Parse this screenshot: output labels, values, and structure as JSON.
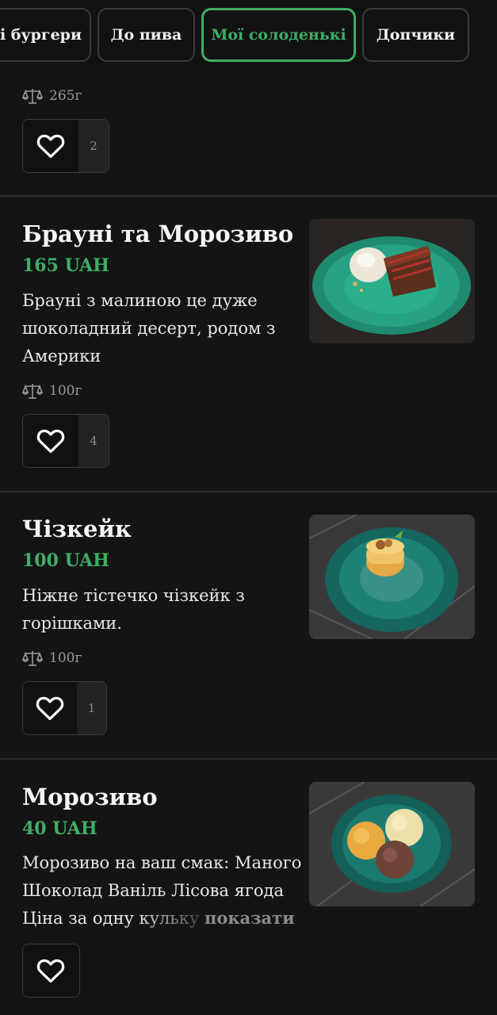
{
  "tabs": [
    {
      "label": "і бургери",
      "active": false
    },
    {
      "label": "До пива",
      "active": false
    },
    {
      "label": "Мої солоденькі",
      "active": true
    },
    {
      "label": "Допчики",
      "active": false
    }
  ],
  "colors": {
    "accent": "#3fae67",
    "background": "#141414"
  },
  "prev_item": {
    "weight": "265г",
    "likes": "2"
  },
  "items": [
    {
      "title": "Брауні та Морозиво",
      "price": "165 UAH",
      "description": [
        "Брауні з малиною це дуже",
        "шоколадний десерт, родом з",
        "Америки"
      ],
      "weight": "100г",
      "likes": "4",
      "image_icon": "brownie-with-ice-cream-photo"
    },
    {
      "title": "Чізкейк",
      "price": "100 UAH",
      "description": [
        "Ніжне тістечко чізкейк з",
        "горішками."
      ],
      "weight": "100г",
      "likes": "1",
      "image_icon": "cheesecake-photo"
    },
    {
      "title": "Морозиво",
      "price": "40 UAH",
      "description": [
        "Морозиво на ваш смак: Маного",
        "Шоколад Ваніль Лісова ягода",
        "Ціна за одну кульку"
      ],
      "show_more": "показати",
      "image_icon": "ice-cream-scoops-photo"
    }
  ]
}
